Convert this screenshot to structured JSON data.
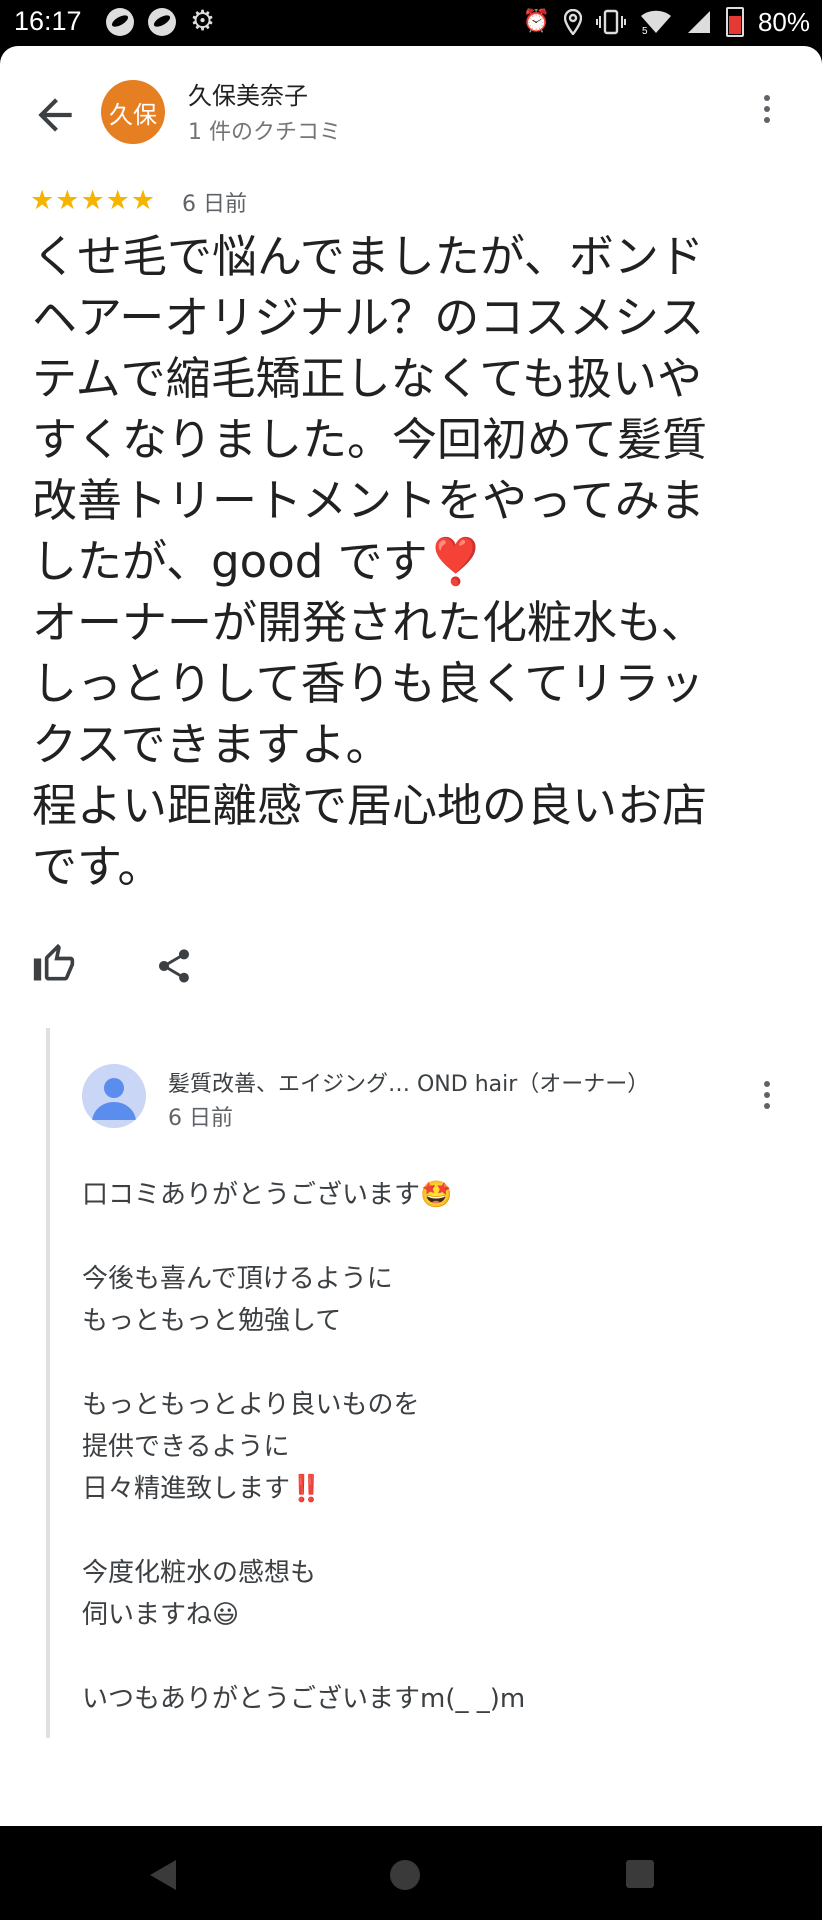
{
  "status_bar": {
    "time": "16:17",
    "battery_percent": "80%",
    "signal_label": "5",
    "icons": [
      "notification-app-icon",
      "notification-app-icon",
      "gear-icon",
      "alarm-icon",
      "location-icon",
      "vibrate-icon",
      "wifi-icon",
      "signal-icon",
      "battery-icon"
    ]
  },
  "review": {
    "avatar_text": "久保",
    "avatar_color": "#e67f22",
    "reviewer_name": "久保美奈子",
    "review_count": "1 件のクチコミ",
    "rating": 5,
    "date": "6 日前",
    "body": "くせ毛で悩んでましたが、ボンド\nヘアーオリジナル？のコスメシス\nテムで縮毛矯正しなくても扱いや\nすくなりました。今回初めて髪質\n改善トリートメントをやってみま\nしたが、good です❣️\nオーナーが開発された化粧水も、\nしっとりして香りも良くてリラッ\nクスできますよ。\n程よい距離感で居心地の良いお店\nです。"
  },
  "owner_reply": {
    "name": "髪質改善、エイジング… OND hair（オーナー）",
    "date": "6 日前",
    "body": "口コミありがとうございます🤩\n\n今後も喜んで頂けるように\nもっともっと勉強して\n\nもっともっとより良いものを\n提供できるように\n日々精進致します‼️\n\n今度化粧水の感想も\n伺いますね😃\n\nいつもありがとうございますm(_ _)m"
  },
  "colors": {
    "star": "#f5b400",
    "text_primary": "#212121",
    "text_secondary": "#5f6368"
  }
}
